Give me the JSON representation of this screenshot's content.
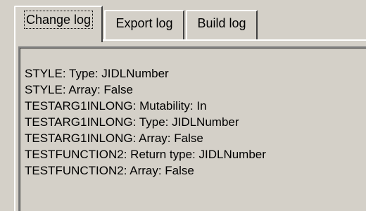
{
  "tabs": [
    {
      "label": "Change log",
      "active": true
    },
    {
      "label": "Export log",
      "active": false
    },
    {
      "label": "Build log",
      "active": false
    }
  ],
  "log": {
    "lines": [
      "STYLE: Type: JIDLNumber",
      "STYLE: Array: False",
      "TESTARG1INLONG: Mutability: In",
      "TESTARG1INLONG: Type: JIDLNumber",
      "TESTARG1INLONG: Array: False",
      "TESTFUNCTION2: Return type: JIDLNumber",
      "TESTFUNCTION2: Array: False"
    ]
  },
  "colors": {
    "face": "#d4d0c8",
    "highlight": "#ffffff",
    "shadow": "#808080",
    "dark_shadow": "#404040",
    "text": "#000000"
  }
}
